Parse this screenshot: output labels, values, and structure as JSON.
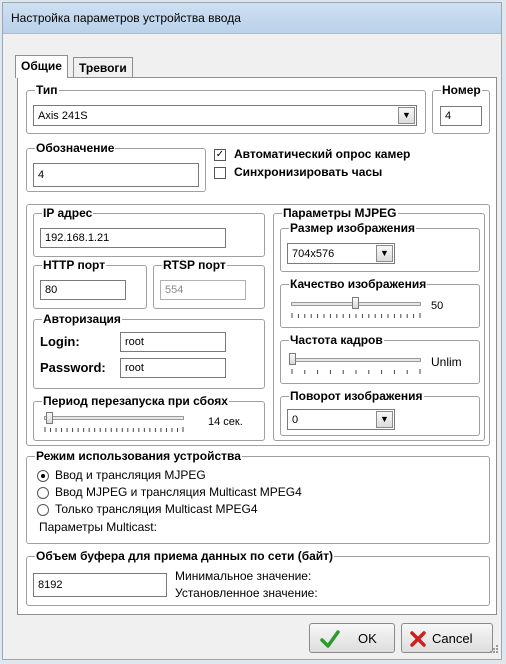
{
  "window": {
    "title": "Настройка параметров устройства ввода"
  },
  "tabs": [
    {
      "label": "Общие",
      "active": true
    },
    {
      "label": "Тревоги",
      "active": false
    }
  ],
  "type_group": {
    "legend": "Тип",
    "value": "Axis 241S"
  },
  "number_group": {
    "legend": "Номер",
    "value": "4"
  },
  "designation_group": {
    "legend": "Обозначение",
    "value": "4"
  },
  "checkboxes": {
    "auto_poll": {
      "label": "Автоматический опрос камер",
      "checked": true
    },
    "sync_clock": {
      "label": "Синхронизировать часы",
      "checked": false
    }
  },
  "ip_group": {
    "legend": "IP адрес",
    "value": "192.168.1.21"
  },
  "http_group": {
    "legend": "HTTP порт",
    "value": "80"
  },
  "rtsp_group": {
    "legend": "RTSP порт",
    "value": "554"
  },
  "auth_group": {
    "legend": "Авторизация",
    "login_label": "Login:",
    "login_value": "root",
    "password_label": "Password:",
    "password_value": "root"
  },
  "restart_group": {
    "legend": "Период перезапуска при сбоях",
    "value_text": "14 сек.",
    "level": 0.03
  },
  "mjpeg": {
    "legend": "Параметры MJPEG",
    "size": {
      "legend": "Размер изображения",
      "value": "704x576"
    },
    "quality": {
      "legend": "Качество изображения",
      "value_text": "50",
      "level": 0.5
    },
    "framerate": {
      "legend": "Частота кадров",
      "value_text": "Unlim",
      "level": 0.0
    },
    "rotation": {
      "legend": "Поворот изображения",
      "value": "0"
    }
  },
  "mode_group": {
    "legend": "Режим использования устройства",
    "options": [
      {
        "label": "Ввод и трансляция MJPEG",
        "selected": true
      },
      {
        "label": "Ввод MJPEG и трансляция Multicast MPEG4",
        "selected": false
      },
      {
        "label": "Только трансляция Multicast MPEG4",
        "selected": false
      }
    ],
    "multicast_label": "Параметры Multicast:"
  },
  "buffer_group": {
    "legend": "Объем буфера для приема данных по сети (байт)",
    "value": "8192",
    "min_label": "Минимальное значение:",
    "set_label": "Установленное значение:"
  },
  "buttons": {
    "ok": "OK",
    "cancel": "Cancel"
  },
  "icons": {
    "check": "check-icon",
    "cross": "cross-icon",
    "dropdown": "chevron-down-icon"
  },
  "colors": {
    "ok_green": "#2e9a2e",
    "cancel_red": "#cc1f1f"
  }
}
